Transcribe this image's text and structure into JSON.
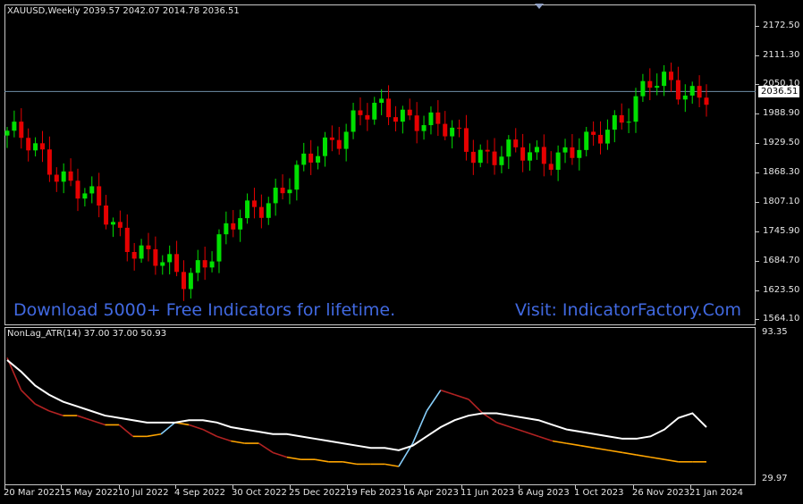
{
  "main_chart": {
    "info_line": "XAUUSD,Weekly  2039.57 2042.07 2014.78 2036.51",
    "current_price_tag": "2036.51",
    "price_axis": [
      "2172.50",
      "2111.30",
      "2050.10",
      "1988.90",
      "1929.50",
      "1868.30",
      "1807.10",
      "1745.90",
      "1684.70",
      "1623.50",
      "1564.10"
    ],
    "promo_left": "Download 5000+ Free Indicators for lifetime.",
    "promo_right": "Visit: IndicatorFactory.Com"
  },
  "indicator": {
    "info_line": "NonLag_ATR(14) 37.00 37.00 50.93",
    "axis_top": "93.35",
    "axis_bottom": "29.97"
  },
  "time_axis": [
    "20 Mar 2022",
    "15 May 2022",
    "10 Jul 2022",
    "4 Sep 2022",
    "30 Oct 2022",
    "25 Dec 2022",
    "19 Feb 2023",
    "16 Apr 2023",
    "11 Jun 2023",
    "6 Aug 2023",
    "1 Oct 2023",
    "26 Nov 2023",
    "21 Jan 2024"
  ],
  "colors": {
    "bull": "#00e000",
    "bear": "#e60000",
    "promo": "#4169e1",
    "nonlag_line": "#ffffff",
    "atr_up": "#87cefa",
    "atr_mid": "#ffa500",
    "atr_down": "#b22222"
  },
  "chart_data": [
    {
      "type": "candlestick",
      "title": "XAUUSD,Weekly",
      "ylim": [
        1564.1,
        2172.5
      ],
      "x": [
        "20 Mar 2022",
        "15 May 2022",
        "10 Jul 2022",
        "4 Sep 2022",
        "30 Oct 2022",
        "25 Dec 2022",
        "19 Feb 2023",
        "16 Apr 2023",
        "11 Jun 2023",
        "6 Aug 2023",
        "1 Oct 2023",
        "26 Nov 2023",
        "21 Jan 2024"
      ],
      "close": [
        1955,
        1862,
        1735,
        1645,
        1770,
        1866,
        1990,
        1990,
        1915,
        1900,
        1920,
        2050,
        2036.51
      ]
    },
    {
      "type": "line",
      "title": "NonLag_ATR(14)",
      "ylim": [
        29.97,
        93.35
      ],
      "series": [
        {
          "name": "NonLag_ATR(14)",
          "values": [
            82,
            68,
            62,
            59,
            57,
            57,
            55,
            53,
            53,
            48,
            48,
            49,
            54,
            53,
            51,
            48,
            46,
            45,
            45,
            41,
            39,
            38,
            38,
            37,
            37,
            36,
            36,
            36,
            35,
            45,
            59,
            68,
            66,
            64,
            58,
            54,
            52,
            50,
            48,
            46,
            45,
            44,
            43,
            42,
            41,
            40,
            39,
            38,
            37,
            37,
            37
          ]
        },
        {
          "name": "NonLag",
          "values": [
            81,
            76,
            70,
            66,
            63,
            61,
            59,
            57,
            56,
            55,
            54,
            54,
            54,
            55,
            55,
            54,
            52,
            51,
            50,
            49,
            49,
            48,
            47,
            46,
            45,
            44,
            43,
            43,
            42,
            44,
            48,
            52,
            55,
            57,
            58,
            58,
            57,
            56,
            55,
            53,
            51,
            50,
            49,
            48,
            47,
            47,
            48,
            51,
            56,
            58,
            52
          ]
        }
      ]
    }
  ]
}
